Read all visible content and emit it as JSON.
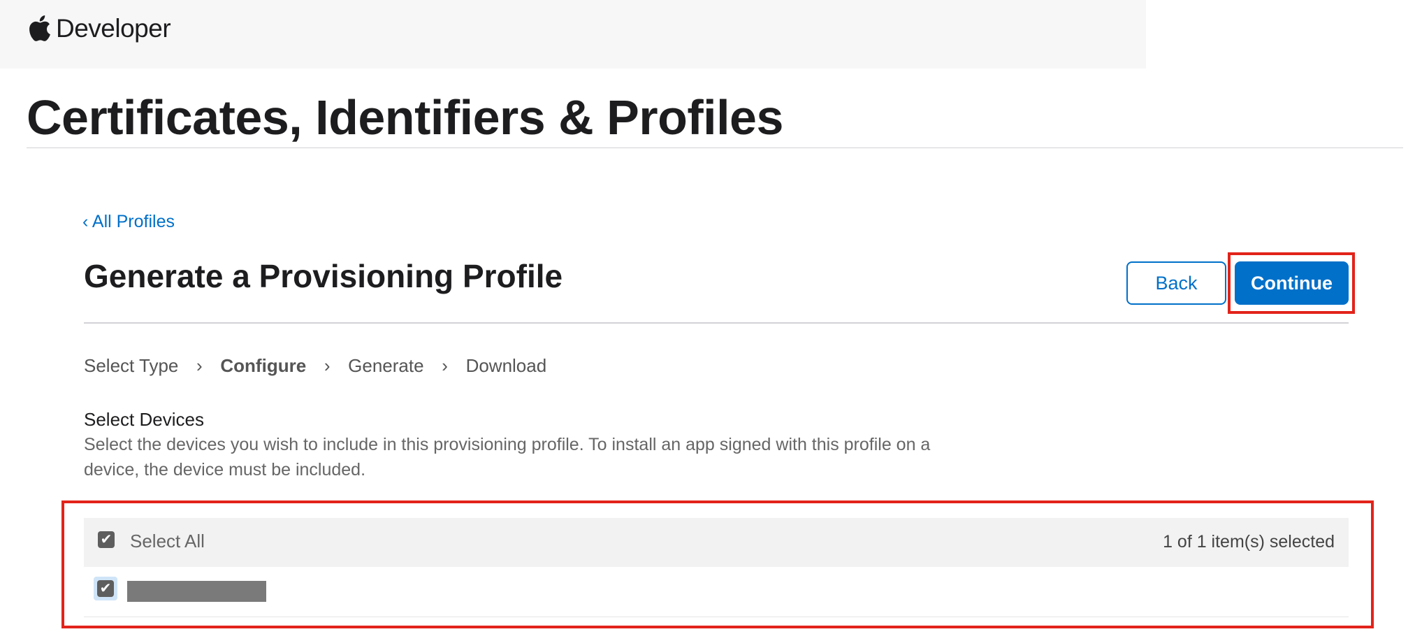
{
  "header": {
    "brand": "Developer"
  },
  "page": {
    "title": "Certificates, Identifiers & Profiles"
  },
  "nav": {
    "back_link": "‹ All Profiles"
  },
  "section": {
    "title": "Generate a Provisioning Profile",
    "back_button": "Back",
    "continue_button": "Continue"
  },
  "steps": {
    "items": [
      "Select Type",
      "Configure",
      "Generate",
      "Download"
    ],
    "active_index": 1
  },
  "devices": {
    "title": "Select Devices",
    "description": "Select the devices you wish to include in this provisioning profile. To install an app signed with this profile on a device, the device must be included.",
    "select_all_label": "Select All",
    "selection_count": "1 of 1 item(s) selected",
    "rows": [
      {
        "checked": true,
        "name_redacted": true
      }
    ]
  },
  "colors": {
    "accent": "#0070c9",
    "highlight": "#e2231a"
  },
  "icons": {
    "logo": "apple-logo",
    "checkbox": "check-icon",
    "step_separator": "chevron-right-icon"
  }
}
